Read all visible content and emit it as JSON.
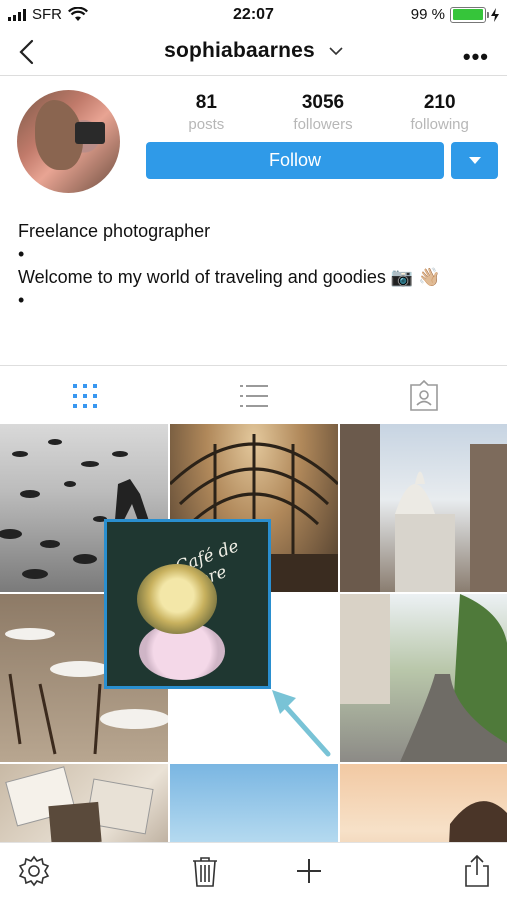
{
  "status_bar": {
    "carrier": "SFR",
    "time": "22:07",
    "battery": "99 %",
    "battery_level": 0.99
  },
  "nav": {
    "title": "sophiabaarnes"
  },
  "profile": {
    "stats": [
      {
        "value": "81",
        "label": "posts"
      },
      {
        "value": "3056",
        "label": "followers"
      },
      {
        "value": "210",
        "label": "following"
      }
    ],
    "follow_label": "Follow",
    "bio": {
      "line1": "Freelance photographer",
      "bullet1": "•",
      "line2": "Welcome to my world of traveling and goodies 📷 👋🏼",
      "bullet2": "•"
    }
  },
  "tabs": [
    "grid-view",
    "list-view",
    "tagged-view"
  ],
  "grid": {
    "items": [
      "pigeons",
      "library-hall",
      "sacre-coeur",
      "cafe-chairs",
      "empty",
      "montmartre-street",
      "photos-on-table",
      "sunset-field",
      "girl-at-sunset"
    ]
  },
  "popup": {
    "caption": "Café de Flore"
  },
  "toolbar": {
    "icons": [
      "gear-icon",
      "trash-icon",
      "plus-icon",
      "share-icon"
    ]
  },
  "colors": {
    "accent": "#2f9ae8",
    "popup_border": "#2a8fcf",
    "battery": "#36c53a"
  }
}
